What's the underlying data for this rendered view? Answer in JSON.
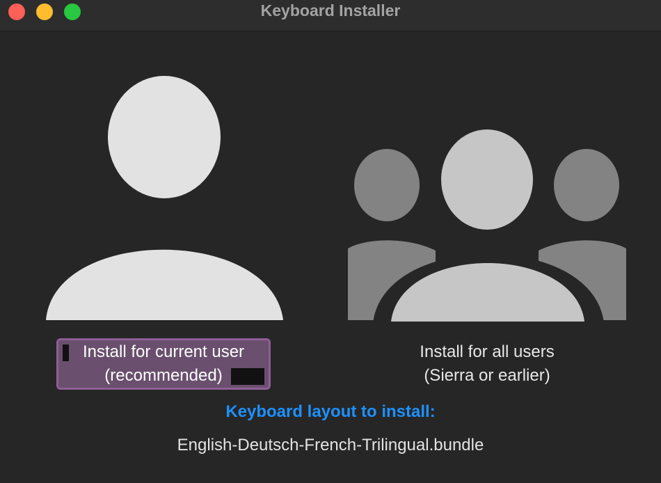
{
  "window": {
    "title": "Keyboard Installer"
  },
  "options": {
    "current_user": {
      "icon": "person-icon",
      "line1": "Install for current user",
      "line2": "(recommended)",
      "selected": true
    },
    "all_users": {
      "icon": "group-icon",
      "line1": "Install for all users",
      "line2": "(Sierra or earlier)",
      "selected": false
    }
  },
  "layout": {
    "heading": "Keyboard layout to install:",
    "bundle": "English-Deutsch-French-Trilingual.bundle"
  },
  "colors": {
    "accent": "#1e90ff",
    "selection": "#8d5f95",
    "close": "#fe5f57",
    "minimize": "#febc2e",
    "maximize": "#28c840"
  }
}
